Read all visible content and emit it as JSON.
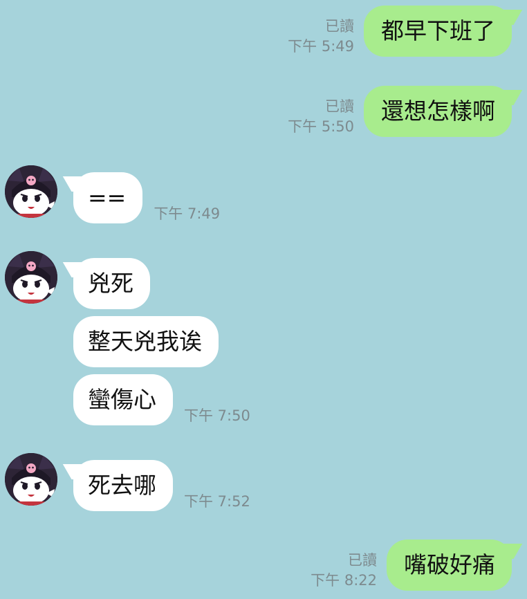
{
  "colors": {
    "background": "#A6D3DB",
    "sent_bubble": "#A8EC8D",
    "received_bubble": "#FFFFFF",
    "meta_text": "#7D8A8E"
  },
  "messages": {
    "m1": {
      "text": "都早下班了",
      "read": "已讀",
      "time": "下午 5:49"
    },
    "m2": {
      "text": "還想怎樣啊",
      "read": "已讀",
      "time": "下午 5:50"
    },
    "m3": {
      "text": "==",
      "time": "下午 7:49"
    },
    "m4": {
      "text": "兇死"
    },
    "m5": {
      "text": "整天兇我诶"
    },
    "m6": {
      "text": "蠻傷心",
      "time": "下午 7:50"
    },
    "m7": {
      "text": "死去哪",
      "time": "下午 7:52"
    },
    "m8": {
      "text": "嘴破好痛",
      "read": "已讀",
      "time": "下午 8:22"
    }
  },
  "contact": {
    "avatar_icon": "kuromi-avatar-icon"
  }
}
